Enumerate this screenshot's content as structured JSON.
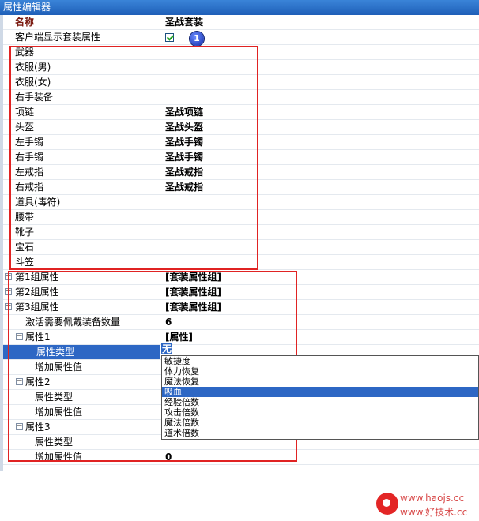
{
  "window": {
    "title": "属性编辑器"
  },
  "rows": [
    {
      "key": "名称",
      "value": "圣战套装",
      "bold_key": true
    },
    {
      "key": "客户端显示套装属性",
      "value": "",
      "checkbox": true
    },
    {
      "key": "武器",
      "value": ""
    },
    {
      "key": "衣服(男)",
      "value": ""
    },
    {
      "key": "衣服(女)",
      "value": ""
    },
    {
      "key": "右手装备",
      "value": ""
    },
    {
      "key": "项链",
      "value": "圣战项链"
    },
    {
      "key": "头盔",
      "value": "圣战头盔"
    },
    {
      "key": "左手镯",
      "value": "圣战手镯"
    },
    {
      "key": "右手镯",
      "value": "圣战手镯"
    },
    {
      "key": "左戒指",
      "value": "圣战戒指"
    },
    {
      "key": "右戒指",
      "value": "圣战戒指"
    },
    {
      "key": "道具(毒符)",
      "value": ""
    },
    {
      "key": "腰带",
      "value": ""
    },
    {
      "key": "靴子",
      "value": ""
    },
    {
      "key": "宝石",
      "value": ""
    },
    {
      "key": "斗笠",
      "value": ""
    },
    {
      "key": "第1组属性",
      "value": "[套装属性组]",
      "expander": "+"
    },
    {
      "key": "第2组属性",
      "value": "[套装属性组]",
      "expander": "+"
    },
    {
      "key": "第3组属性",
      "value": "[套装属性组]",
      "expander": "+"
    },
    {
      "key": "激活需要佩戴装备数量",
      "value": "6",
      "indent": 1
    },
    {
      "key": "属性1",
      "value": "[属性]",
      "expander": "−",
      "indent": 1
    },
    {
      "key": "属性类型",
      "value": "无",
      "indent": 2,
      "selected": true
    },
    {
      "key": "增加属性值",
      "value": "",
      "indent": 2
    },
    {
      "key": "属性2",
      "value": "",
      "expander": "−",
      "indent": 1
    },
    {
      "key": "属性类型",
      "value": "",
      "indent": 2
    },
    {
      "key": "增加属性值",
      "value": "",
      "indent": 2
    },
    {
      "key": "属性3",
      "value": "",
      "expander": "−",
      "indent": 1
    },
    {
      "key": "属性类型",
      "value": "",
      "indent": 2
    },
    {
      "key": "增加属性值",
      "value": "0",
      "indent": 2
    }
  ],
  "dropdown": {
    "current": "无",
    "options": [
      "敏捷度",
      "体力恢复",
      "魔法恢复",
      "吸血",
      "经验倍数",
      "攻击倍数",
      "魔法倍数",
      "道术倍数"
    ],
    "highlighted": "吸血"
  },
  "badge": {
    "label": "1"
  },
  "watermark": {
    "line1": "www.haojs.cc",
    "line2": "www.好技术.cc"
  },
  "colors": {
    "annotation_red": "#e02323",
    "selection_blue": "#2d67c4",
    "title_blue": "#2a6ec8"
  }
}
